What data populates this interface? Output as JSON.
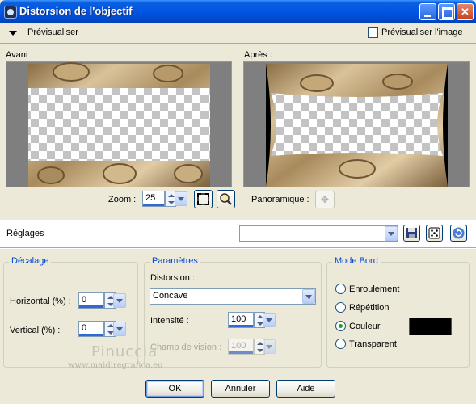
{
  "window": {
    "title": "Distorsion de l'objectif"
  },
  "preview": {
    "toggle_label": "Prévisualiser",
    "image_checkbox_label": "Prévisualiser l'image",
    "image_checkbox_checked": false,
    "before_label": "Avant :",
    "after_label": "Après :"
  },
  "zoom": {
    "label": "Zoom :",
    "value": "25",
    "pan_label": "Panoramique :"
  },
  "settings": {
    "label": "Réglages",
    "selected": ""
  },
  "offset": {
    "legend": "Décalage",
    "horizontal_label": "Horizontal (%) :",
    "horizontal_value": "0",
    "vertical_label": "Vertical (%) :",
    "vertical_value": "0"
  },
  "params": {
    "legend": "Paramètres",
    "distortion_label": "Distorsion :",
    "distortion_value": "Concave",
    "intensity_label": "Intensité :",
    "intensity_value": "100",
    "fov_label": "Champ de vision :",
    "fov_value": "100"
  },
  "edge_mode": {
    "legend": "Mode Bord",
    "options": [
      "Enroulement",
      "Répétition",
      "Couleur",
      "Transparent"
    ],
    "selected": "Couleur",
    "color": "#000000"
  },
  "watermark": {
    "line1": "Pinuccia",
    "line2": "www.maidiregrafica.eu"
  },
  "buttons": {
    "ok": "OK",
    "cancel": "Annuler",
    "help": "Aide"
  },
  "colors": {
    "title_bar": "#0054e3",
    "dialog_bg": "#ece9d8",
    "group_legend": "#0046d5",
    "accent_underline": "#3168d5"
  }
}
